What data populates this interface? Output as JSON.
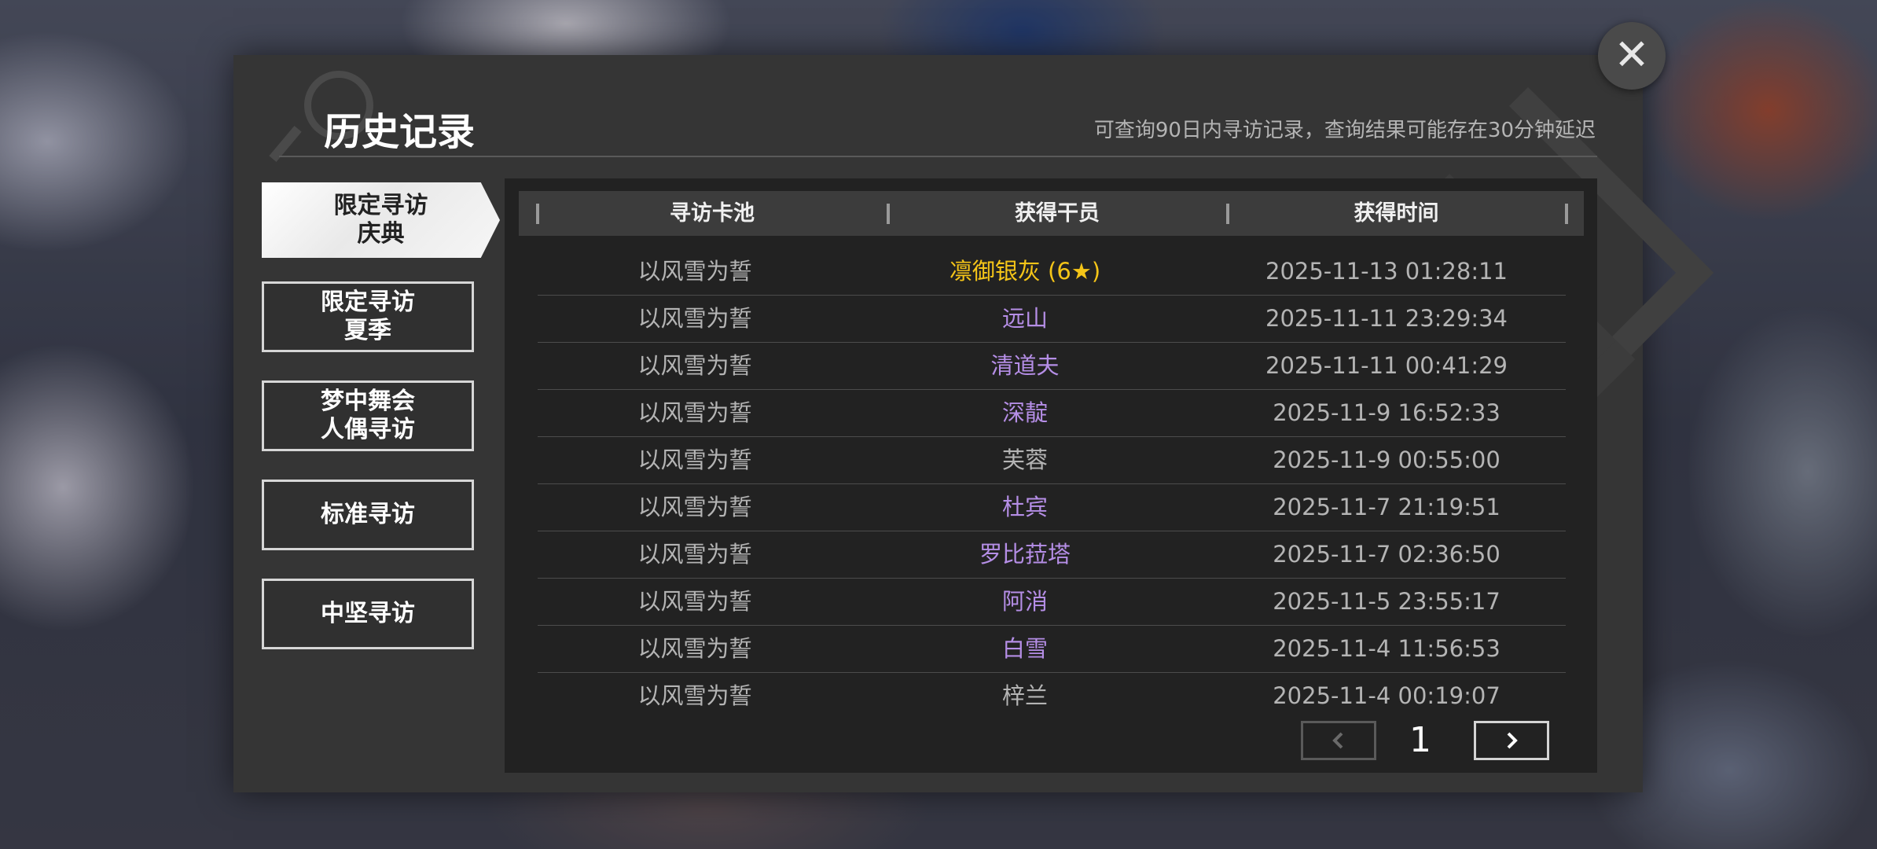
{
  "title": "历史记录",
  "hint": "可查询90日内寻访记录，查询结果可能存在30分钟延迟",
  "colors": {
    "six_star": "#f5c518",
    "five_star": "#b58ee6",
    "normal": "#b4b4b4"
  },
  "sidebar": {
    "items": [
      {
        "label": "限定寻访\n庆典",
        "active": true
      },
      {
        "label": "限定寻访\n夏季",
        "active": false
      },
      {
        "label": "梦中舞会\n人偶寻访",
        "active": false
      },
      {
        "label": "标准寻访",
        "active": false
      },
      {
        "label": "中坚寻访",
        "active": false
      }
    ]
  },
  "table": {
    "headers": [
      "寻访卡池",
      "获得干员",
      "获得时间"
    ],
    "rows": [
      {
        "pool": "以风雪为誓",
        "operator": "凛御银灰 (6★)",
        "rarity": "six_star",
        "time": "2025-11-13 01:28:11"
      },
      {
        "pool": "以风雪为誓",
        "operator": "远山",
        "rarity": "five_star",
        "time": "2025-11-11 23:29:34"
      },
      {
        "pool": "以风雪为誓",
        "operator": "清道夫",
        "rarity": "five_star",
        "time": "2025-11-11 00:41:29"
      },
      {
        "pool": "以风雪为誓",
        "operator": "深靛",
        "rarity": "five_star",
        "time": "2025-11-9 16:52:33"
      },
      {
        "pool": "以风雪为誓",
        "operator": "芙蓉",
        "rarity": "normal",
        "time": "2025-11-9 00:55:00"
      },
      {
        "pool": "以风雪为誓",
        "operator": "杜宾",
        "rarity": "five_star",
        "time": "2025-11-7 21:19:51"
      },
      {
        "pool": "以风雪为誓",
        "operator": "罗比菈塔",
        "rarity": "five_star",
        "time": "2025-11-7 02:36:50"
      },
      {
        "pool": "以风雪为誓",
        "operator": "阿消",
        "rarity": "five_star",
        "time": "2025-11-5 23:55:17"
      },
      {
        "pool": "以风雪为誓",
        "operator": "白雪",
        "rarity": "five_star",
        "time": "2025-11-4 11:56:53"
      },
      {
        "pool": "以风雪为誓",
        "operator": "梓兰",
        "rarity": "normal",
        "time": "2025-11-4 00:19:07"
      }
    ]
  },
  "pager": {
    "page": "1",
    "prev_icon": "chevron-left-icon",
    "next_icon": "chevron-right-icon"
  },
  "close_icon": "close-icon"
}
